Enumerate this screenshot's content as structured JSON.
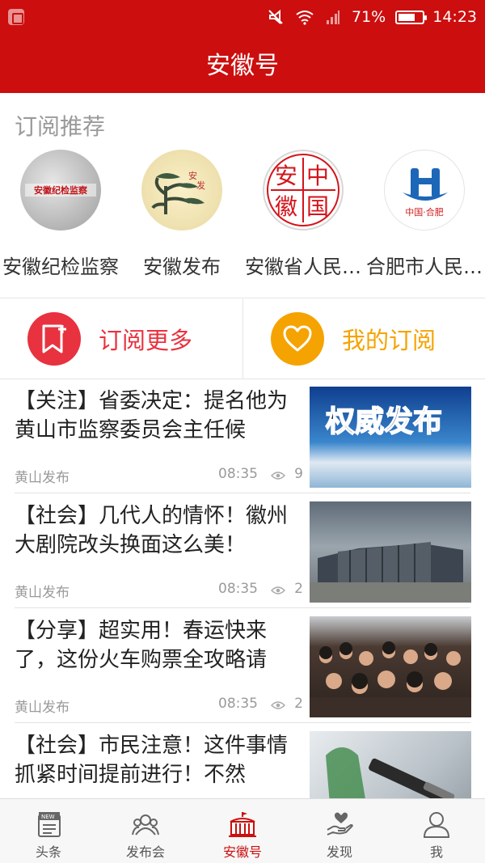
{
  "status_bar": {
    "battery": "71%",
    "time": "14:23",
    "battery_level": 0.71
  },
  "header": {
    "title": "安徽号"
  },
  "recommend": {
    "title": "订阅推荐",
    "items": [
      {
        "name": "安徽纪检监察",
        "logo": "安徽纪检监察"
      },
      {
        "name": "安徽发布",
        "logo": ""
      },
      {
        "name": "安徽省人民…",
        "logo": ""
      },
      {
        "name": "合肥市人民…",
        "logo": "中国·合肥"
      }
    ]
  },
  "actions": {
    "more": {
      "label": "订阅更多",
      "color": "#e8323f"
    },
    "mine": {
      "label": "我的订阅",
      "color": "#f5a300"
    }
  },
  "news": [
    {
      "title": "【关注】省委决定：提名他为黄山市监察委员会主任候",
      "source": "黄山发布",
      "time": "08:35",
      "views": "9",
      "image": "权威发布"
    },
    {
      "title": "【社会】几代人的情怀！徽州大剧院改头换面这么美！",
      "source": "黄山发布",
      "time": "08:35",
      "views": "2",
      "image": "theater-photo"
    },
    {
      "title": "【分享】超实用！春运快来了，这份火车购票全攻略请",
      "source": "黄山发布",
      "time": "08:35",
      "views": "2",
      "image": "crowd-photo"
    },
    {
      "title": "【社会】市民注意！这件事情抓紧时间提前进行！不然",
      "source": "",
      "time": "",
      "views": "",
      "image": "tool-photo"
    }
  ],
  "nav": [
    {
      "label": "头条",
      "icon": "news-icon"
    },
    {
      "label": "发布会",
      "icon": "people-icon"
    },
    {
      "label": "安徽号",
      "icon": "building-icon",
      "active": true
    },
    {
      "label": "发现",
      "icon": "heart-hand-icon"
    },
    {
      "label": "我",
      "icon": "user-icon"
    }
  ],
  "colors": {
    "brand": "#cc0e0e"
  }
}
